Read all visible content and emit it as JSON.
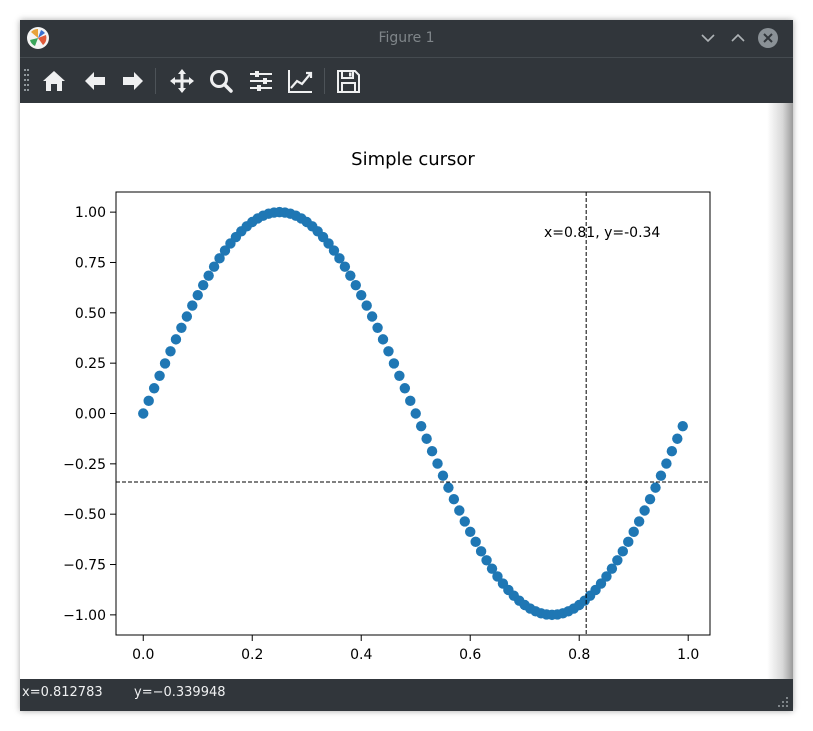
{
  "window": {
    "title": "Figure 1"
  },
  "toolbar": {
    "items": [
      {
        "name": "home-button",
        "icon": "home-icon"
      },
      {
        "name": "back-button",
        "icon": "arrow-left-icon"
      },
      {
        "name": "forward-button",
        "icon": "arrow-right-icon"
      },
      {
        "name": "pan-button",
        "icon": "move-icon"
      },
      {
        "name": "zoom-button",
        "icon": "magnifier-icon"
      },
      {
        "name": "subplots-button",
        "icon": "sliders-icon"
      },
      {
        "name": "edit-axes-button",
        "icon": "line-chart-icon"
      },
      {
        "name": "save-button",
        "icon": "floppy-disk-icon"
      }
    ]
  },
  "chart_data": {
    "type": "scatter",
    "title": "Simple cursor",
    "function": "sin(2*pi*x)",
    "x_start": 0.0,
    "x_step": 0.01,
    "x_count": 100,
    "xlim": [
      -0.05,
      1.04
    ],
    "ylim": [
      -1.1,
      1.1
    ],
    "xticks": [
      "0.0",
      "0.2",
      "0.4",
      "0.6",
      "0.8",
      "1.0"
    ],
    "xtick_values": [
      0.0,
      0.2,
      0.4,
      0.6,
      0.8,
      1.0
    ],
    "yticks": [
      "1.00",
      "0.75",
      "0.50",
      "0.25",
      "0.00",
      "−0.25",
      "−0.50",
      "−0.75",
      "−1.00"
    ],
    "ytick_values": [
      1.0,
      0.75,
      0.5,
      0.25,
      0.0,
      -0.25,
      -0.5,
      -0.75,
      -1.0
    ],
    "cursor": {
      "x": 0.812783,
      "y": -0.339948,
      "label": "x=0.81, y=-0.34"
    },
    "marker_color": "#1f77b4",
    "grid": false
  },
  "status": {
    "x_text": "x=0.812783",
    "y_text": "y=−0.339948"
  },
  "colors": {
    "chrome": "#31363b",
    "close_button": "#8a9196"
  }
}
